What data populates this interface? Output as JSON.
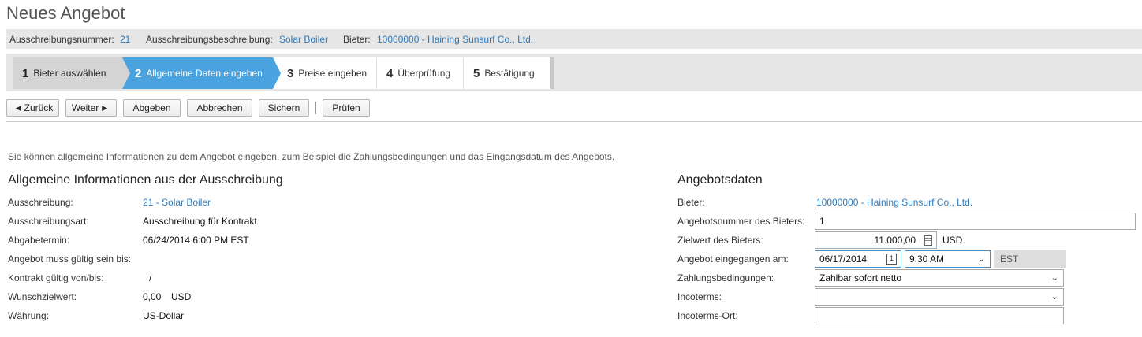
{
  "page": {
    "title": "Neues Angebot"
  },
  "infobar": {
    "rfq_number_label": "Ausschreibungsnummer:",
    "rfq_number_value": "21",
    "rfq_desc_label": "Ausschreibungsbeschreibung:",
    "rfq_desc_value": "Solar Boiler",
    "bidder_label": "Bieter:",
    "bidder_value": "10000000 - Haining Sunsurf Co., Ltd."
  },
  "steps": [
    {
      "num": "1",
      "label": "Bieter auswählen",
      "state": "done"
    },
    {
      "num": "2",
      "label": "Allgemeine Daten eingeben",
      "state": "active"
    },
    {
      "num": "3",
      "label": "Preise eingeben",
      "state": "todo"
    },
    {
      "num": "4",
      "label": "Überprüfung",
      "state": "todo"
    },
    {
      "num": "5",
      "label": "Bestätigung",
      "state": "todo"
    }
  ],
  "toolbar": {
    "back_label": "Zurück",
    "next_label": "Weiter",
    "submit_label": "Abgeben",
    "cancel_label": "Abbrechen",
    "save_label": "Sichern",
    "check_label": "Prüfen"
  },
  "intro": "Sie können allgemeine Informationen zu dem Angebot eingeben, zum Beispiel die Zahlungsbedingungen und das Eingangsdatum des Angebots.",
  "general": {
    "title": "Allgemeine Informationen aus der Ausschreibung",
    "rows": [
      {
        "label": "Ausschreibung:",
        "value": "21 - Solar Boiler"
      },
      {
        "label": "Ausschreibungsart:",
        "value": "Ausschreibung für Kontrakt"
      },
      {
        "label": "Abgabetermin:",
        "value": "06/24/2014 6:00 PM EST"
      },
      {
        "label": "Angebot muss gültig sein bis:",
        "value": ""
      },
      {
        "label": "Kontrakt gültig von/bis:",
        "value": "/"
      },
      {
        "label": "Wunschzielwert:",
        "value": "0,00",
        "unit": "USD"
      },
      {
        "label": "Währung:",
        "value": "US-Dollar"
      }
    ]
  },
  "bid": {
    "title": "Angebotsdaten",
    "bidder_label": "Bieter:",
    "bidder_value": "10000000 - Haining Sunsurf Co., Ltd.",
    "bid_number_label": "Angebotsnummer des Bieters:",
    "bid_number_value": "1",
    "target_label": "Zielwert des Bieters:",
    "target_value": "11.000,00",
    "target_currency": "USD",
    "received_label": "Angebot eingegangen am:",
    "received_date": "06/17/2014",
    "received_time": "9:30 AM",
    "received_tz": "EST",
    "payment_label": "Zahlungsbedingungen:",
    "payment_value": "Zahlbar sofort netto",
    "incoterms_label": "Incoterms:",
    "incoterms_value": "",
    "incoterms_place_label": "Incoterms-Ort:",
    "incoterms_place_value": ""
  }
}
